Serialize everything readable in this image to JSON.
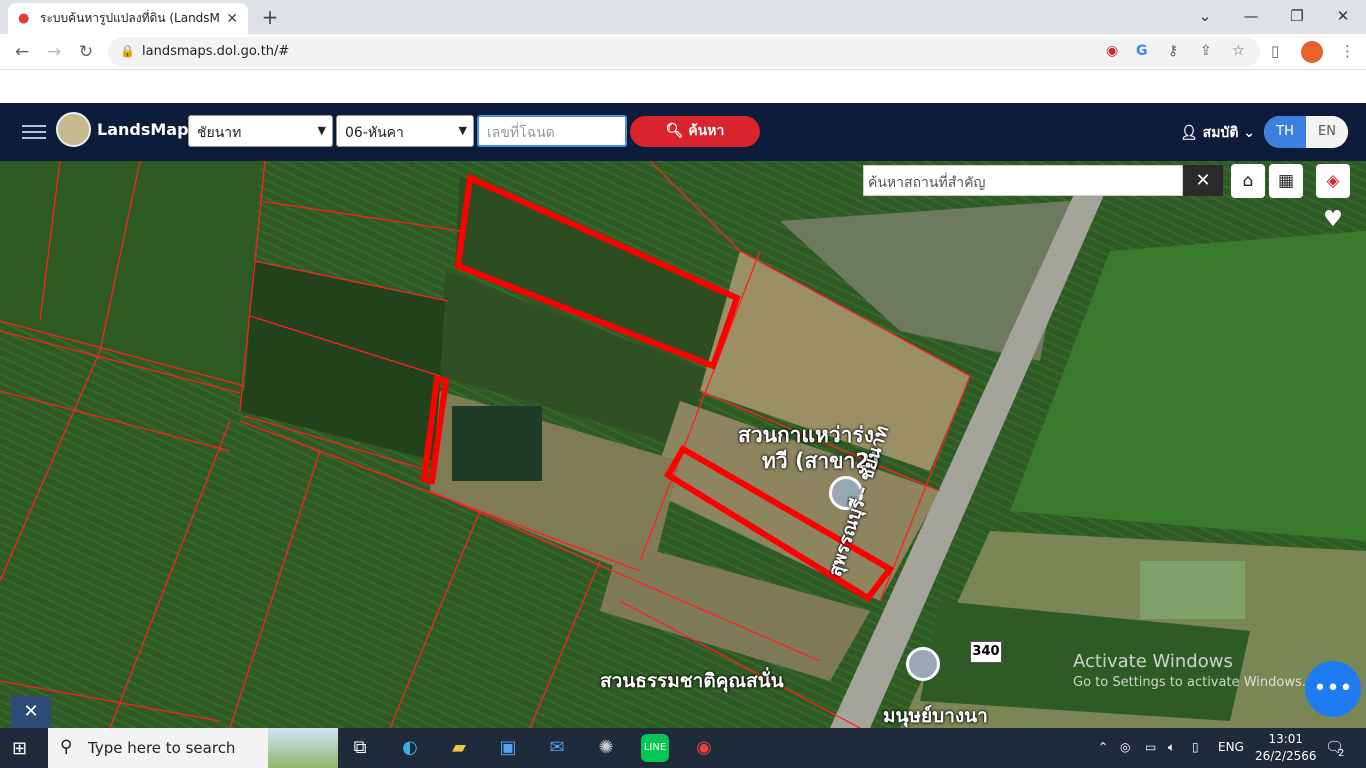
{
  "browser": {
    "tab_title": "ระบบค้นหารูปแปลงที่ดิน (LandsMaps",
    "tab_close": "✕",
    "new_tab": "+",
    "url": "landsmaps.dol.go.th/#",
    "win_min": "—",
    "win_restore": "❐",
    "win_close": "✕"
  },
  "site": {
    "brand": "LandsMaps",
    "province": "ชัยนาท",
    "district": "06-หันคา",
    "deed_placeholder": "เลขที่โฉนด",
    "search_button": "ค้นหา",
    "user_name": "สมบัติ",
    "lang_th": "TH",
    "lang_en": "EN"
  },
  "map": {
    "place_search_placeholder": "ค้นหาสถานที่สำคัญ",
    "place_close": "✕",
    "labels": {
      "coffee_line1": "สวนกาแหว่าร่ง",
      "coffee_line2": "ทวี (สาขา2)",
      "park": "สวนธรรมชาติคุณสนั่น",
      "village": "มนุษย์บางนา",
      "road": "สุพรรณบุรี - ชัยนาท",
      "route_no": "340"
    },
    "activate_line1": "Activate Windows",
    "activate_line2": "Go to Settings to activate Windows.",
    "fab": "•••"
  },
  "taskbar": {
    "search_text": "Type here to search",
    "lang": "ENG",
    "time": "13:01",
    "date": "26/2/2566",
    "notif_count": "2"
  },
  "colors": {
    "header_bg": "#0e1c3b",
    "accent_red": "#d9232d",
    "parcel_red": "#ff0000",
    "lang_active": "#3d7fe0"
  }
}
